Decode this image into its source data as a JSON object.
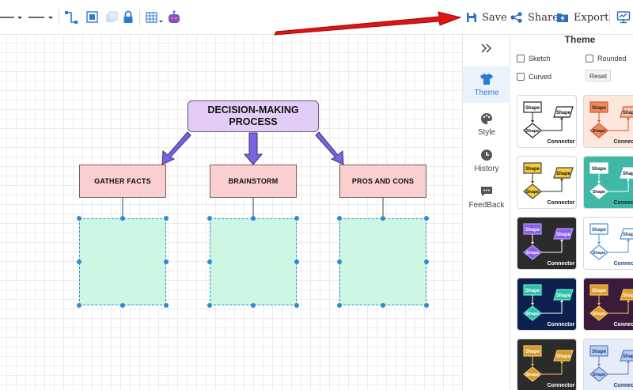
{
  "toolbar": {
    "save_label": "Save",
    "share_label": "Share",
    "export_label": "Export"
  },
  "diagram": {
    "title_line1": "DECISION-MAKING",
    "title_line2": "PROCESS",
    "nodes": [
      "GATHER FACTS",
      "BRAINSTORM",
      "PROS AND CONS"
    ]
  },
  "sidebar": {
    "items": [
      {
        "label": "Theme",
        "icon": "shirt-icon"
      },
      {
        "label": "Style",
        "icon": "palette-icon"
      },
      {
        "label": "History",
        "icon": "clock-icon"
      },
      {
        "label": "FeedBack",
        "icon": "feedback-icon"
      }
    ]
  },
  "theme_panel": {
    "title": "Theme",
    "options": {
      "sketch": "Sketch",
      "rounded": "Rounded",
      "curved": "Curved"
    },
    "reset_label": "Reset",
    "thumb_shape_label": "Shape",
    "thumb_connector_label": "Connector"
  },
  "colors": {
    "accent": "#2a7cd2",
    "title_node": "#e3cdf7",
    "sub_node": "#f9cfcf",
    "box": "#cdf7e3",
    "arrow": "#7a63e0",
    "pointer_arrow": "#e01414"
  }
}
